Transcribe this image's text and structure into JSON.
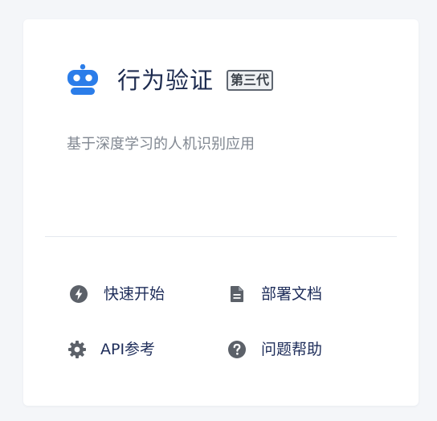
{
  "header": {
    "logo_icon": "robot-icon",
    "title": "行为验证",
    "badge": "第三代",
    "accent_color": "#2b7de9"
  },
  "subtitle": "基于深度学习的人机识别应用",
  "links": [
    {
      "label": "快速开始",
      "icon": "lightning-bolt-icon"
    },
    {
      "label": "部署文档",
      "icon": "document-icon"
    },
    {
      "label": "API参考",
      "icon": "gear-icon"
    },
    {
      "label": "问题帮助",
      "icon": "question-circle-icon"
    }
  ],
  "colors": {
    "background": "#f4f6f9",
    "card": "#ffffff",
    "title": "#1d2b4f",
    "link_text": "#1e2d5a",
    "icon": "#5c6169",
    "subtitle": "#808791"
  }
}
